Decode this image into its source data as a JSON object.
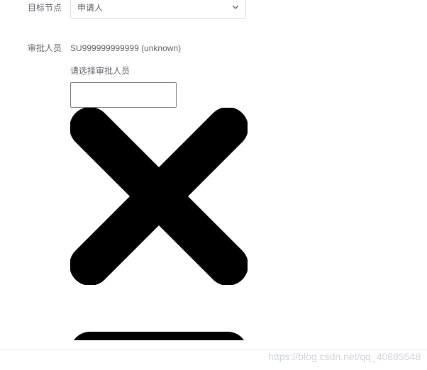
{
  "form": {
    "target_node": {
      "label": "目标节点",
      "value": "申请人"
    },
    "approver": {
      "label": "审批人员",
      "value": "SU999999999999 (unknown)",
      "hint": "请选择审批人员",
      "input_value": ""
    }
  },
  "watermark": "https://blog.csdn.net/qq_40885548",
  "icons": {
    "select_arrow": "chevron-down-icon",
    "large_icon": "close-icon"
  }
}
